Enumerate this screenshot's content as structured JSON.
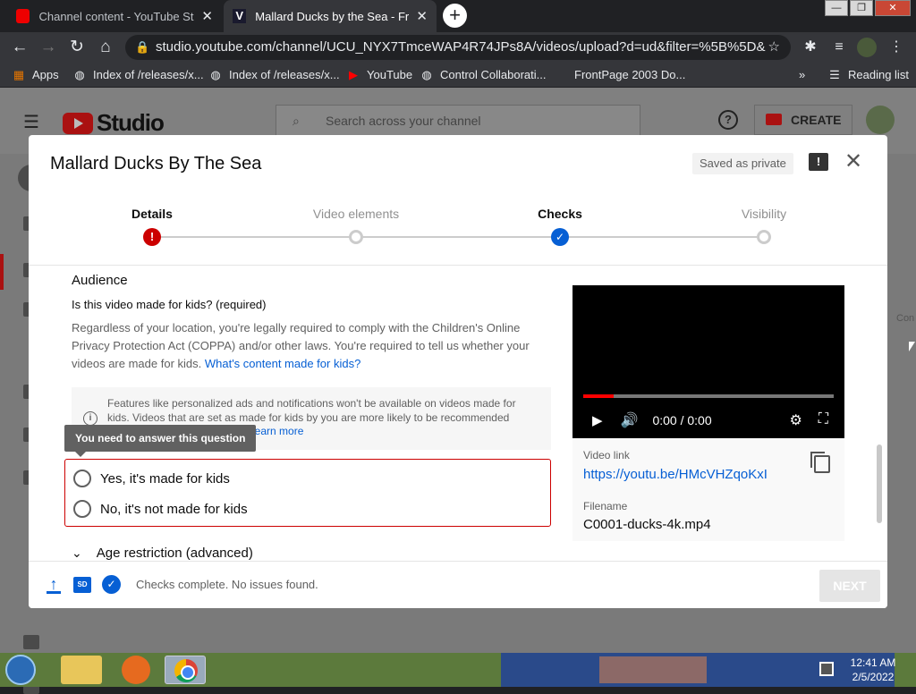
{
  "browser": {
    "tabs": [
      {
        "title": "Channel content - YouTube Studio",
        "favicon": "youtube-icon",
        "active": false
      },
      {
        "title": "Mallard Ducks by the Sea - Free Stock Video",
        "favicon": "vimeo-icon",
        "active": true
      }
    ],
    "new_tab_glyph": "+",
    "window_controls": [
      "—",
      "❐",
      "✕"
    ],
    "url": "studio.youtube.com/channel/UCU_NYX7TmceWAP4R74JPs8A/videos/upload?d=ud&filter=%5B%5D&",
    "bookmarks": [
      {
        "label": "Apps",
        "icon": "apps-grid-icon"
      },
      {
        "label": "Index of /releases/x...",
        "icon": "globe-icon"
      },
      {
        "label": "Index of /releases/x...",
        "icon": "globe-icon"
      },
      {
        "label": "YouTube",
        "icon": "youtube-icon"
      },
      {
        "label": "Control Collaborati...",
        "icon": "globe-icon"
      },
      {
        "label": "FrontPage 2003 Do...",
        "icon": "page-icon"
      }
    ],
    "overflow": "»",
    "reading_list": "Reading list"
  },
  "studio": {
    "logo_text": "Studio",
    "search_placeholder": "Search across your channel",
    "create_label": "CREATE",
    "help_glyph": "?"
  },
  "modal": {
    "title": "Mallard Ducks By The Sea",
    "saved_badge": "Saved as private",
    "feedback_glyph": "!",
    "close_glyph": "✕",
    "steps": [
      {
        "label": "Details",
        "state": "error",
        "glyph": "!"
      },
      {
        "label": "Video elements",
        "state": "pending",
        "glyph": ""
      },
      {
        "label": "Checks",
        "state": "done",
        "glyph": "✓"
      },
      {
        "label": "Visibility",
        "state": "pending",
        "glyph": ""
      }
    ],
    "audience": {
      "heading": "Audience",
      "question": "Is this video made for kids? (required)",
      "description": "Regardless of your location, you're legally required to comply with the Children's Online Privacy Protection Act (COPPA) and/or other laws. You're required to tell us whether your videos are made for kids.",
      "description_link": "What's content made for kids?",
      "info_text": "Features like personalized ads and notifications won't be available on videos made for kids. Videos that are set as made for kids by you are more likely to be recommended",
      "info_link": "Learn more",
      "tooltip": "You need to answer this question",
      "options": [
        "Yes, it's made for kids",
        "No, it's not made for kids"
      ],
      "age_restriction": "Age restriction (advanced)"
    },
    "preview": {
      "time": "0:00 / 0:00",
      "progress_fraction": 0.12,
      "video_link_label": "Video link",
      "video_link": "https://youtu.be/HMcVHZqoKxI",
      "filename_label": "Filename",
      "filename": "C0001-ducks-4k.mp4"
    },
    "footer": {
      "status": "Checks complete. No issues found.",
      "hd_badge": "SD",
      "next_label": "NEXT"
    }
  },
  "taskbar": {
    "time": "12:41 AM",
    "date": "2/5/2022"
  },
  "background_text": "Con"
}
